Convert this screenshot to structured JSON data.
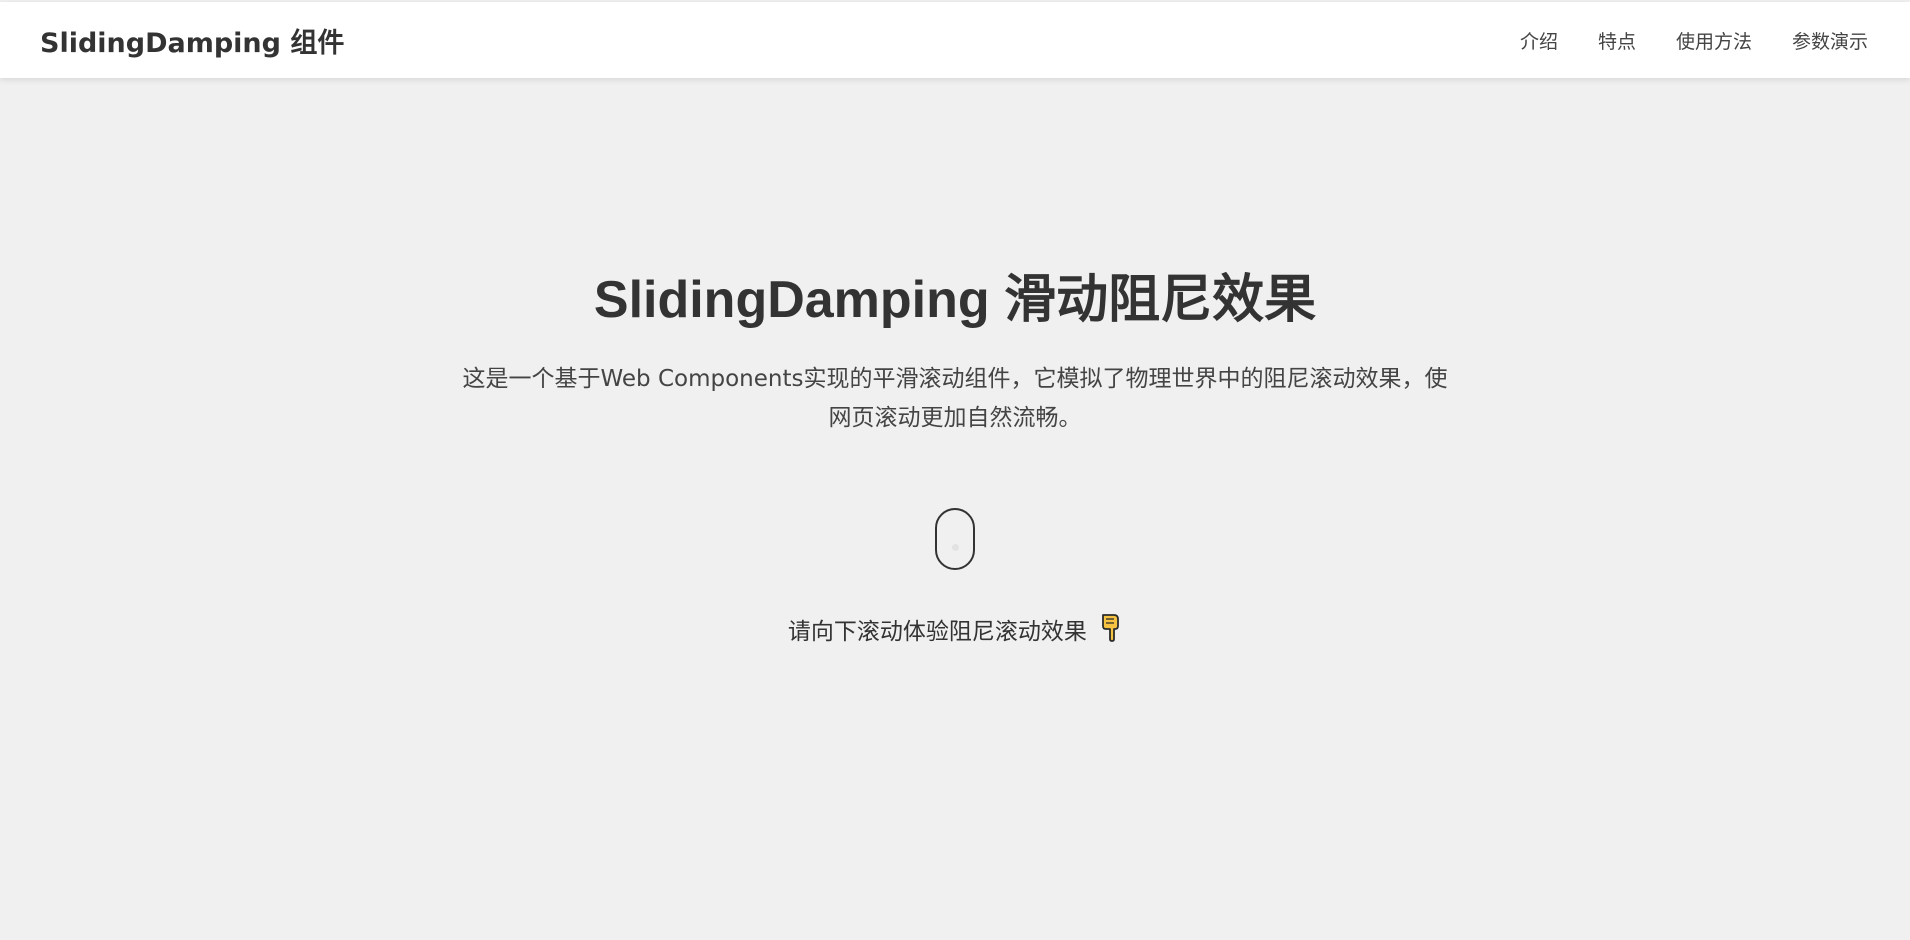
{
  "header": {
    "brand": "SlidingDamping 组件",
    "nav": [
      {
        "label": "介绍"
      },
      {
        "label": "特点"
      },
      {
        "label": "使用方法"
      },
      {
        "label": "参数演示"
      }
    ]
  },
  "hero": {
    "title": "SlidingDamping 滑动阻尼效果",
    "description": "这是一个基于Web Components实现的平滑滚动组件，它模拟了物理世界中的阻尼滚动效果，使网页滚动更加自然流畅。",
    "scroll_hint": "请向下滚动体验阻尼滚动效果",
    "scroll_icon": "mouse-scroll-icon",
    "hint_icon": "pointing-down-hand-icon"
  },
  "colors": {
    "background": "#f0f0f0",
    "header_bg": "#ffffff",
    "text": "#333333",
    "hand_fill": "#f5c242"
  }
}
